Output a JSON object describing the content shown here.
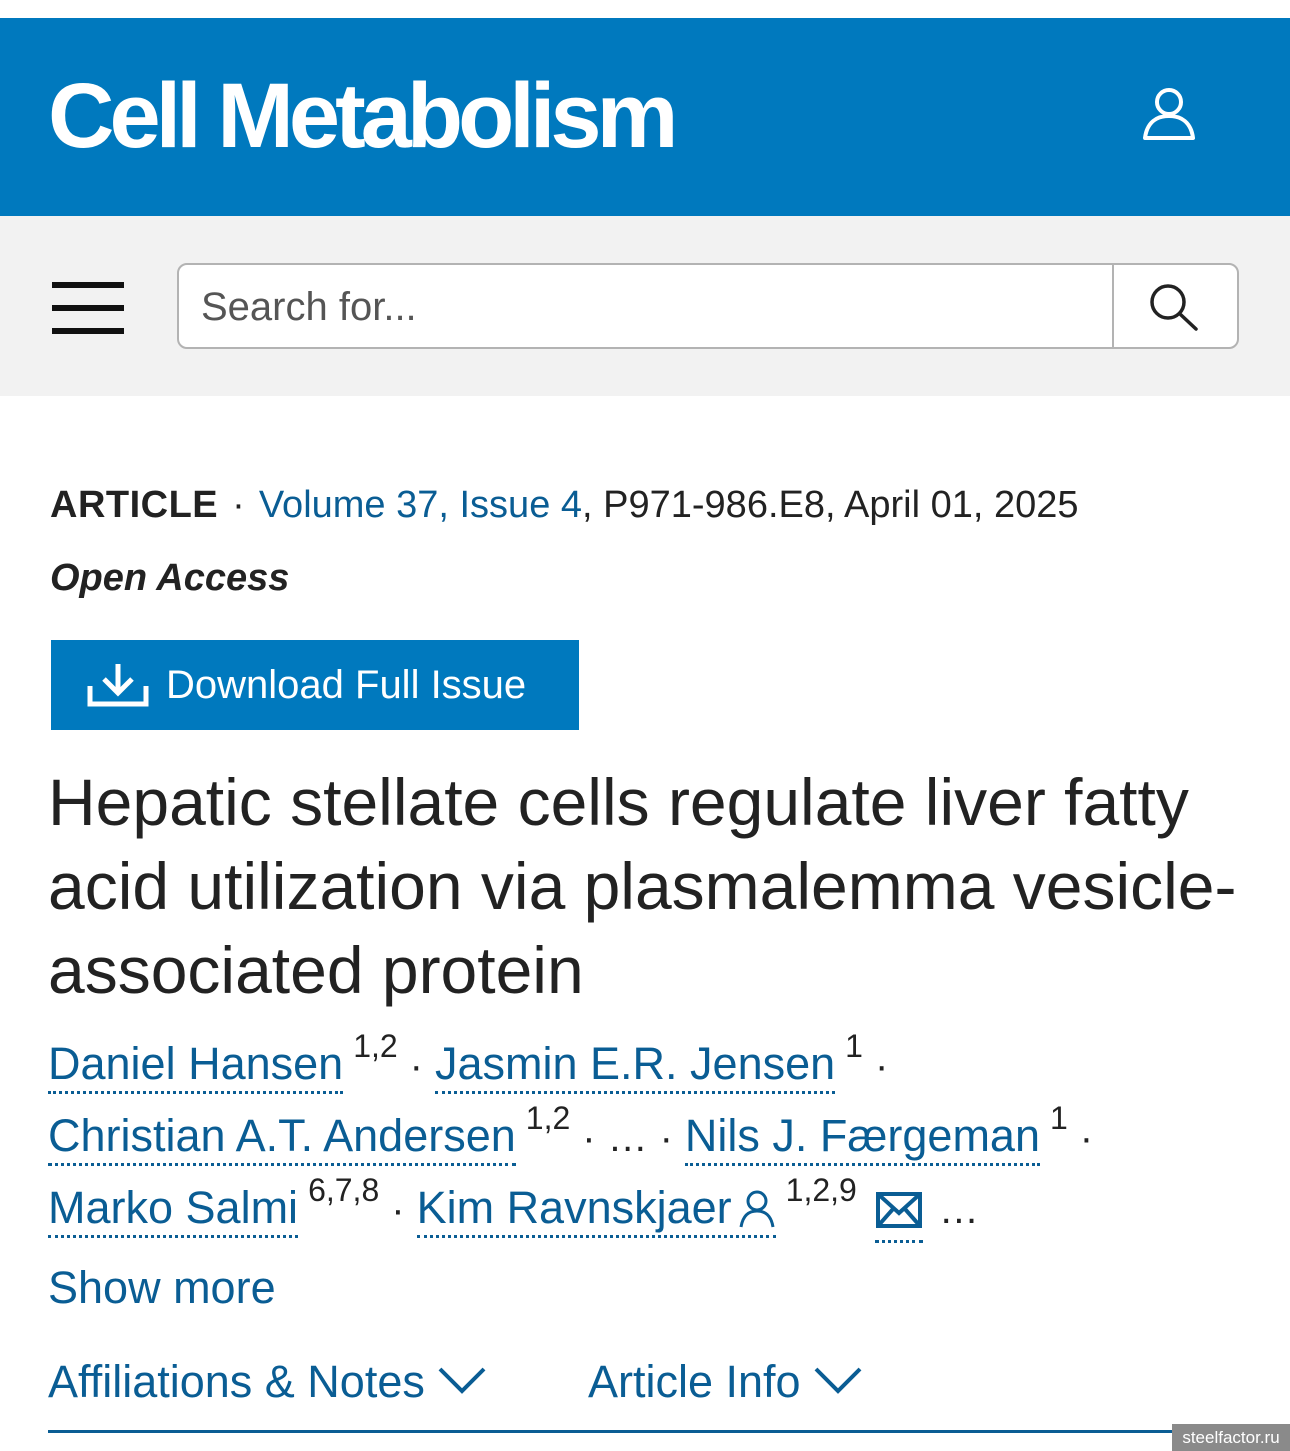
{
  "journal": {
    "name": "Cell Metabolism"
  },
  "search": {
    "placeholder": "Search for..."
  },
  "meta": {
    "article_type": "ARTICLE",
    "separator": "·",
    "volume_issue": "Volume 37, Issue 4",
    "pages_date": ", P971-986.E8, April 01, 2025",
    "access": "Open Access"
  },
  "download": {
    "label": "Download Full Issue"
  },
  "article": {
    "title": "Hepatic stellate cells regulate liver fatty acid utilization via plasmalemma vesicle-associated protein"
  },
  "authors": [
    {
      "name": "Daniel Hansen",
      "aff": "1,2"
    },
    {
      "name": "Jasmin E.R. Jensen",
      "aff": "1"
    },
    {
      "name": "Christian A.T. Andersen",
      "aff": "1,2"
    },
    {
      "name": "Nils J. Færgeman",
      "aff": "1"
    },
    {
      "name": "Marko Salmi",
      "aff": "6,7,8"
    },
    {
      "name": "Kim Ravnskjaer",
      "aff": "1,2,9"
    }
  ],
  "ellipsis": "…",
  "show_more": "Show more",
  "tabs": [
    {
      "label": "Affiliations & Notes"
    },
    {
      "label": "Article Info"
    }
  ],
  "watermark": "steelfactor.ru",
  "colors": {
    "brand": "#0079be",
    "link": "#0a5d94"
  },
  "icons": [
    "user-icon",
    "menu-icon",
    "search-icon",
    "download-icon",
    "corresponding-author-icon",
    "mail-icon",
    "chevron-down-icon"
  ]
}
